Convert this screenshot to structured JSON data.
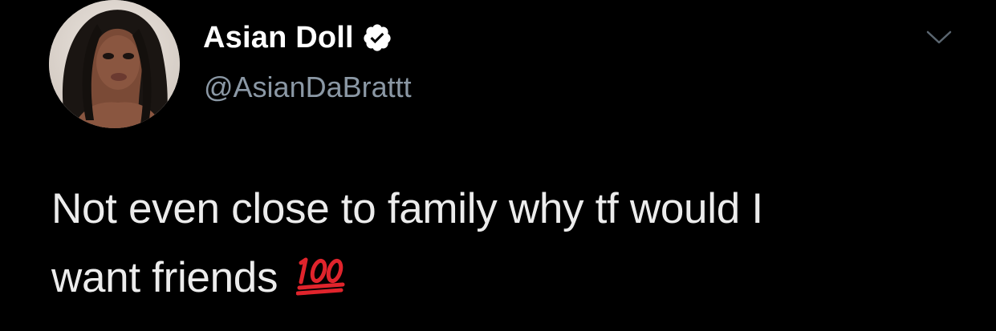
{
  "tweet": {
    "author": {
      "display_name": "Asian Doll",
      "handle": "@AsianDaBrattt",
      "verified": true,
      "avatar_icon": "profile-photo"
    },
    "text_line1": "Not even close to family why tf would I",
    "text_line2": "want friends",
    "emoji": "hundred-points-emoji",
    "menu_icon": "chevron-down-icon"
  },
  "colors": {
    "background": "#000000",
    "name": "#ffffff",
    "handle": "#8b98a5",
    "text": "#ececec",
    "verified_badge": "#ffffff",
    "emoji_red": "#e0242c"
  }
}
